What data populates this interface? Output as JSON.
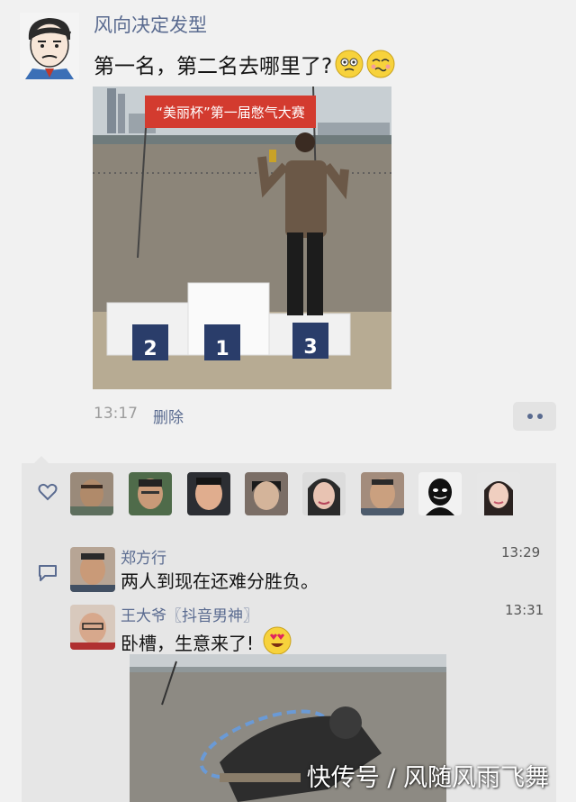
{
  "post": {
    "author": "风向决定发型",
    "text": "第一名，第二名去哪里了?",
    "banner_text": "“美丽杯”第一届憋气大赛",
    "podium_numbers": [
      "2",
      "1",
      "3"
    ],
    "time": "13:17",
    "delete_label": "删除",
    "emojis": [
      "worried-face-icon",
      "woozy-face-icon"
    ]
  },
  "likes": {
    "icon": "heart-outline-icon",
    "count_avatars": 8
  },
  "comments": [
    {
      "name": "郑方行",
      "time": "13:29",
      "text": "两人到现在还难分胜负。"
    },
    {
      "name": "王大爷〖抖音男神〗",
      "time": "13:31",
      "text": "卧槽，生意来了!",
      "emoji": "heart-eyes-face-icon"
    }
  ],
  "watermark": "快传号 / 风随风雨飞舞",
  "colors": {
    "link": "#5a6b90",
    "background": "#f1f1f1",
    "comment_bg": "#e6e6e6"
  }
}
